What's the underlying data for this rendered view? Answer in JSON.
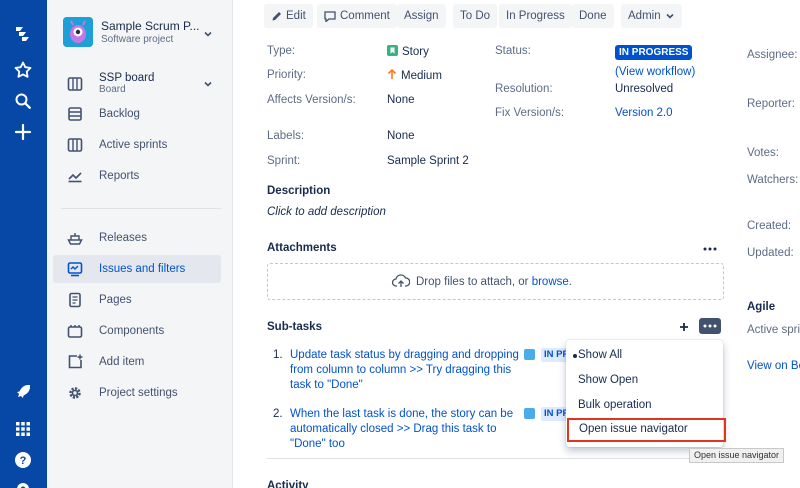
{
  "global_nav": {
    "items": [
      "jira-logo-icon",
      "star-icon",
      "search-icon",
      "plus-icon"
    ],
    "bottom": [
      "rocket-icon",
      "app-switcher-icon",
      "help-icon",
      "settings-icon"
    ]
  },
  "sidebar": {
    "project_name": "Sample Scrum P...",
    "project_type": "Software project",
    "board_name": "SSP board",
    "board_type": "Board",
    "items": [
      {
        "label": "Backlog",
        "icon": "backlog-icon"
      },
      {
        "label": "Active sprints",
        "icon": "columns-icon"
      },
      {
        "label": "Reports",
        "icon": "chart-icon"
      },
      {
        "label": "Releases",
        "icon": "ship-icon"
      },
      {
        "label": "Issues and filters",
        "icon": "issues-filters-icon"
      },
      {
        "label": "Pages",
        "icon": "page-icon"
      },
      {
        "label": "Components",
        "icon": "components-icon"
      },
      {
        "label": "Add item",
        "icon": "add-item-icon"
      },
      {
        "label": "Project settings",
        "icon": "gear-icon"
      }
    ]
  },
  "toolbar": {
    "edit": "Edit",
    "comment": "Comment",
    "assign": "Assign",
    "todo": "To Do",
    "inprogress": "In Progress",
    "done": "Done",
    "admin": "Admin"
  },
  "details": {
    "type_label": "Type:",
    "type_value": "Story",
    "priority_label": "Priority:",
    "priority_value": "Medium",
    "affects_label": "Affects Version/s:",
    "affects_value": "None",
    "labels_label": "Labels:",
    "labels_value": "None",
    "sprint_label": "Sprint:",
    "sprint_value": "Sample Sprint 2",
    "status_label": "Status:",
    "status_value": "IN PROGRESS",
    "workflow_link": "(View workflow)",
    "resolution_label": "Resolution:",
    "resolution_value": "Unresolved",
    "fix_label": "Fix Version/s:",
    "fix_value": "Version 2.0"
  },
  "people": {
    "assignee": "Assignee:",
    "reporter": "Reporter:",
    "votes": "Votes:",
    "watchers": "Watchers:",
    "created": "Created:",
    "updated": "Updated:"
  },
  "agile": {
    "heading": "Agile",
    "active_sprint": "Active sprin",
    "view_on_board": "View on Bo"
  },
  "description": {
    "heading": "Description",
    "placeholder": "Click to add description"
  },
  "attachments": {
    "heading": "Attachments",
    "drop_text": "Drop files to attach, or ",
    "browse": "browse",
    "period": "."
  },
  "subtasks": {
    "heading": "Sub-tasks",
    "items": [
      {
        "num": "1.",
        "lines": [
          "Update task status by dragging and dropping",
          "from column to column >> Try dragging this",
          "task to \"Done\""
        ],
        "status": "IN PROGRESS"
      },
      {
        "num": "2.",
        "lines": [
          "When the last task is done, the story can be",
          "automatically closed >> Drag this task to",
          "\"Done\" too"
        ],
        "status": "IN PROGRESS"
      }
    ]
  },
  "activity": {
    "heading": "Activity"
  },
  "menu": {
    "items": [
      "Show All",
      "Show Open",
      "Bulk operation",
      "Open issue navigator"
    ],
    "selected": "Show All",
    "highlighted": "Open issue navigator"
  },
  "tooltip": "Open issue navigator",
  "colors": {
    "nav": "#0747a6",
    "link": "#0052cc",
    "highlight": "#e0341e",
    "story": "#36b37e",
    "priority_medium": "#ff7a1a"
  }
}
